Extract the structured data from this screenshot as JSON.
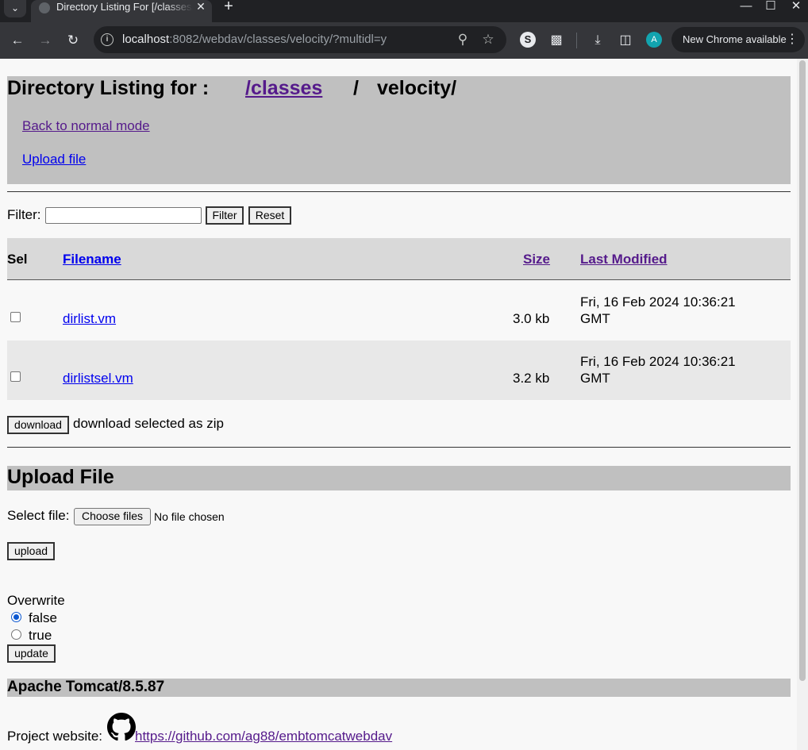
{
  "browser": {
    "tab_title": "Directory Listing For [/classes/velocity/]",
    "url_host": "localhost",
    "url_rest": ":8082/webdav/classes/velocity/?multidl=y",
    "avatar_letter": "A",
    "update_label": "New Chrome available"
  },
  "page": {
    "heading": {
      "prefix": "Directory Listing for :",
      "path_link": "/classes",
      "separator": "/",
      "current": "velocity/"
    },
    "back_link": "Back to normal mode",
    "upload_link": "Upload file",
    "filter": {
      "label": "Filter:",
      "value": "",
      "filter_button": "Filter",
      "reset_button": "Reset"
    },
    "table": {
      "headers": {
        "sel": "Sel",
        "filename": "Filename",
        "size": "Size",
        "modified": "Last Modified"
      },
      "rows": [
        {
          "name": "dirlist.vm",
          "size": "3.0 kb",
          "modified_line1": "Fri, 16 Feb 2024 10:36:21",
          "modified_line2": "GMT",
          "selected": false
        },
        {
          "name": "dirlistsel.vm",
          "size": "3.2 kb",
          "modified_line1": "Fri, 16 Feb 2024 10:36:21",
          "modified_line2": "GMT",
          "selected": false
        }
      ]
    },
    "download": {
      "button": "download",
      "caption": "download selected as zip"
    },
    "upload": {
      "heading": "Upload File",
      "select_label": "Select file:",
      "choose_button": "Choose files",
      "no_file": "No file chosen",
      "upload_button": "upload"
    },
    "overwrite": {
      "label": "Overwrite",
      "options": [
        {
          "label": "false",
          "checked": true
        },
        {
          "label": "true",
          "checked": false
        }
      ],
      "update_button": "update"
    },
    "footer": {
      "server": "Apache Tomcat/8.5.87",
      "project_label": "Project website:",
      "project_url": "https://github.com/ag88/embtomcatwebdav"
    }
  },
  "colors": {
    "link": "#0000ee",
    "visited_link": "#551a8b",
    "header_bg": "#c0c0c0",
    "table_head_bg": "#d9d9d9",
    "alt_row_bg": "#e8e8e8"
  },
  "icons": [
    "tab-list-icon",
    "favicon-icon",
    "close-icon",
    "plus-icon",
    "minimize-icon",
    "maximize-icon",
    "back-icon",
    "forward-icon",
    "reload-icon",
    "site-info-icon",
    "zoom-icon",
    "bookmark-star-icon",
    "sync-icon",
    "extensions-icon",
    "download-icon",
    "side-panel-icon",
    "menu-dots-icon",
    "github-icon"
  ]
}
